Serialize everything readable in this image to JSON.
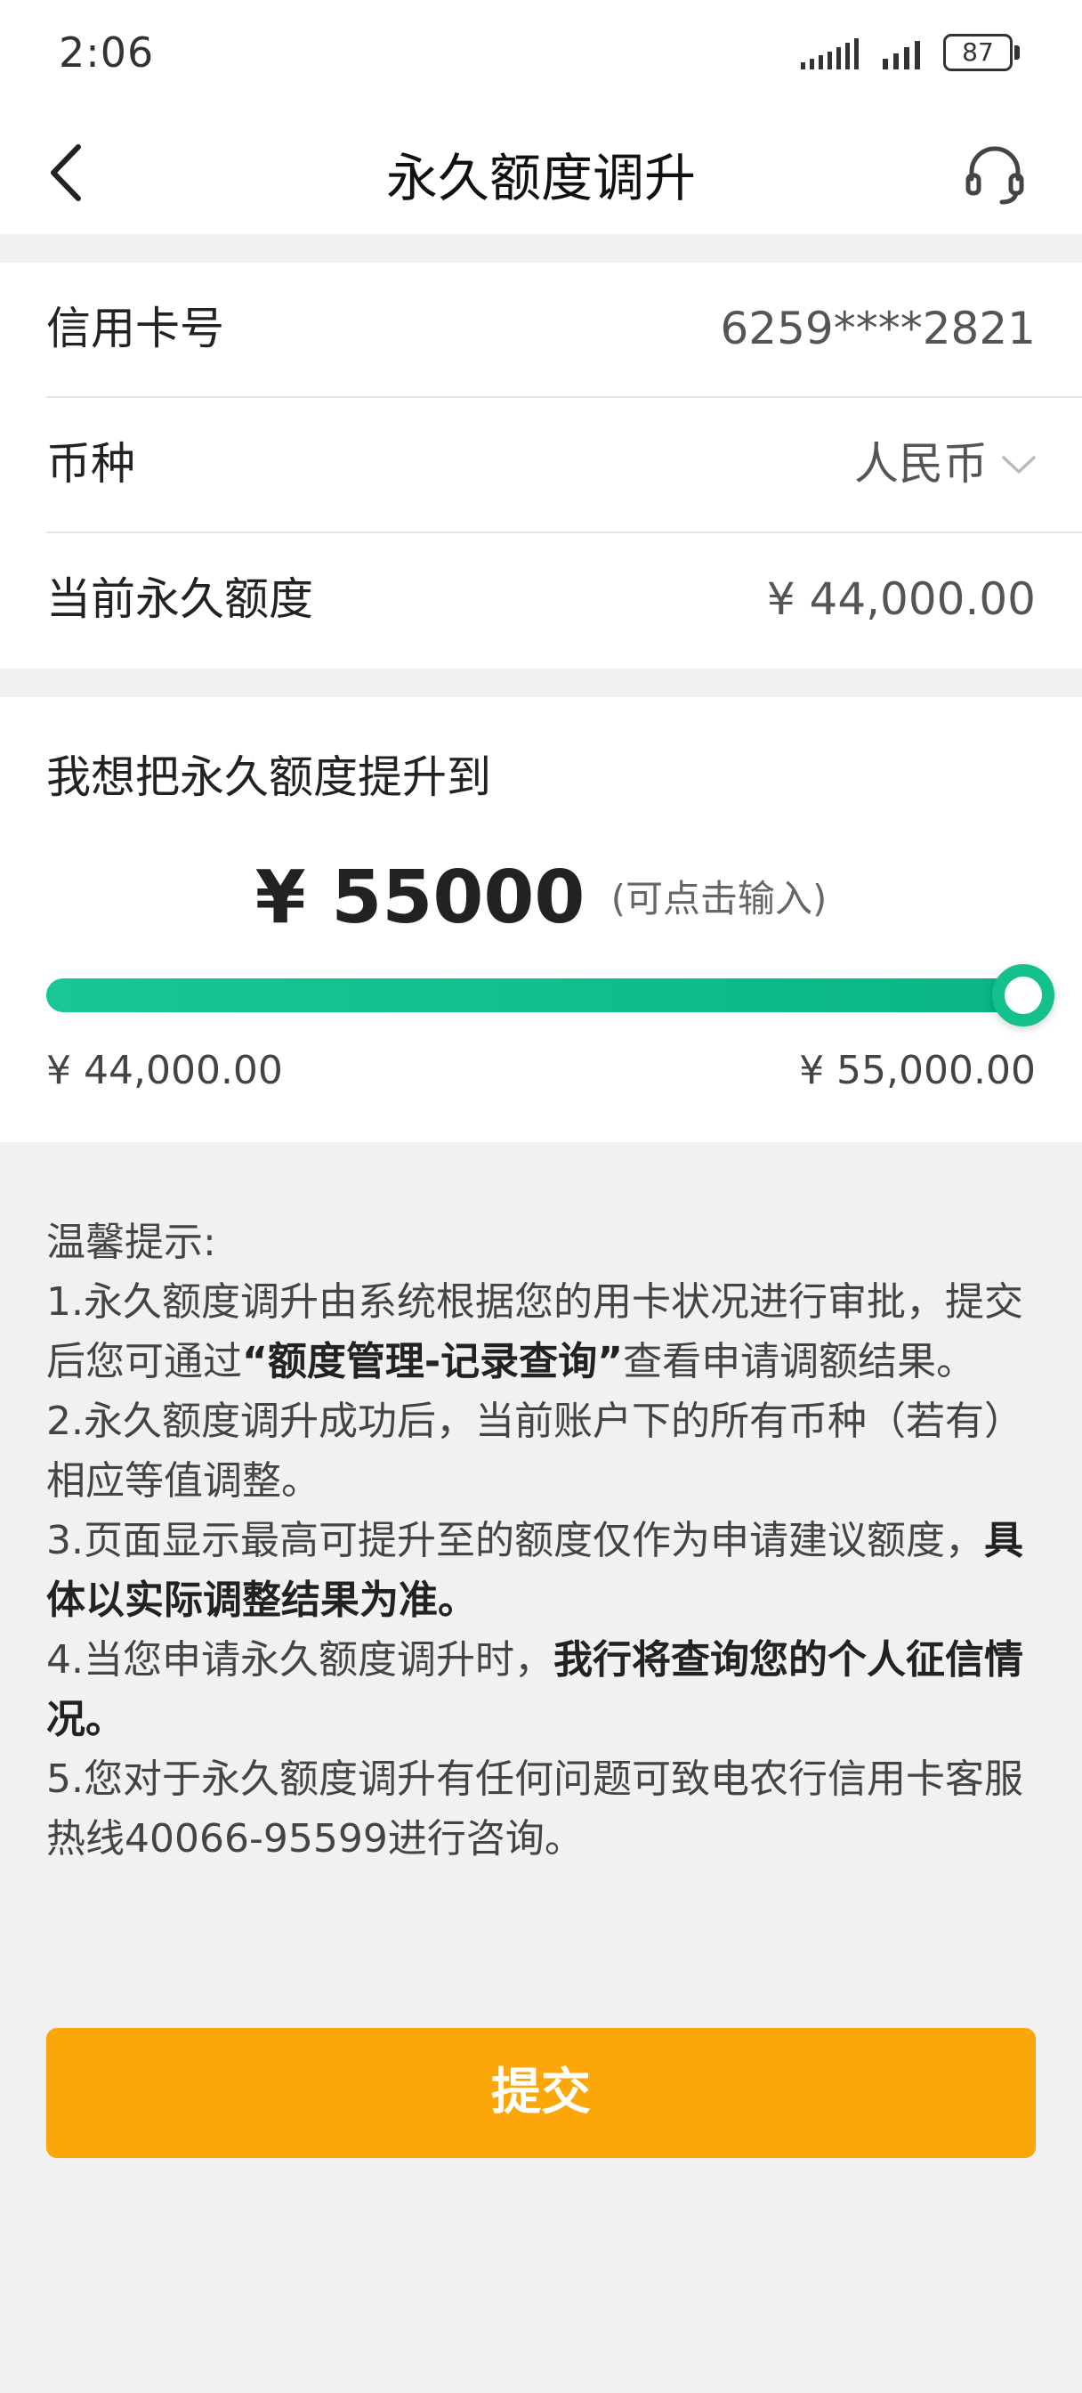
{
  "status_bar": {
    "time": "2:06",
    "battery": "87"
  },
  "nav": {
    "title": "永久额度调升"
  },
  "card_info": {
    "card_label": "信用卡号",
    "card_number": "6259****2821",
    "currency_label": "币种",
    "currency_value": "人民币",
    "current_limit_label": "当前永久额度",
    "current_limit_value": "¥ 44,000.00"
  },
  "adjust": {
    "heading": "我想把永久额度提升到",
    "target_amount": "¥ 55000",
    "input_hint": "(可点击输入)",
    "slider_min_label": "¥ 44,000.00",
    "slider_max_label": "¥ 55,000.00",
    "slider_fraction": 1.0
  },
  "tips": {
    "title": "温馨提示:",
    "item1_a": " 1.永久额度调升由系统根据您的用卡状况进行审批，提交后您可通过",
    "item1_bold": "“额度管理-记录查询”",
    "item1_b": "查看申请调额结果。",
    "item2": "2.永久额度调升成功后，当前账户下的所有币种（若有）相应等值调整。",
    "item3_a": " 3.页面显示最高可提升至的额度仅作为申请建议额度，",
    "item3_bold": "具体以实际调整结果为准。",
    "item4_a": " 4.当您申请永久额度调升时，",
    "item4_bold": "我行将查询您的个人征信情况。",
    "item5": "5.您对于永久额度调升有任何问题可致电农行信用卡客服热线40066-95599进行咨询。"
  },
  "submit_label": "提交",
  "colors": {
    "accent_green": "#13c08e",
    "submit_orange": "#fba70a"
  },
  "icons": {
    "back": "back-arrow-icon",
    "headset": "headset-icon",
    "chevron": "chevron-down-icon",
    "signal": "signal-icon",
    "battery": "battery-icon"
  }
}
